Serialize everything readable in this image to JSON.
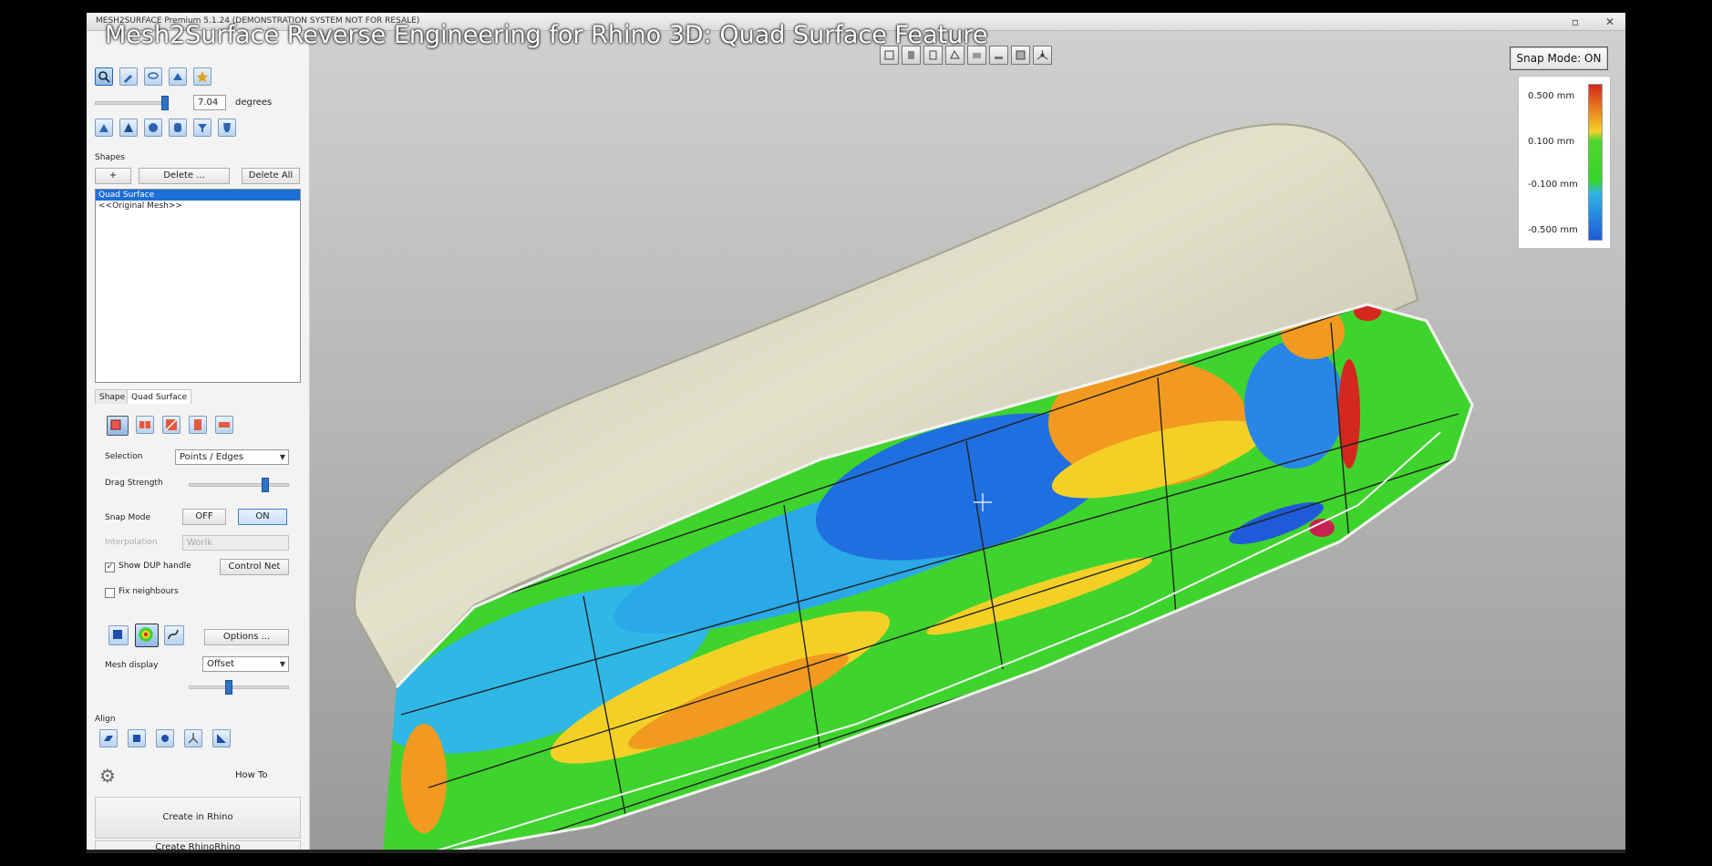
{
  "window": {
    "app_title": "MESH2SURFACE Premium 5.1.24 (DEMONSTRATION SYSTEM NOT FOR RESALE)",
    "video_title": "Mesh2Surface Reverse Engineering for Rhino 3D: Quad Surface Feature"
  },
  "panel": {
    "angle_value": "7.04",
    "angle_unit": "degrees",
    "shapes_header": "Shapes",
    "add_label": "+",
    "delete_label": "Delete ...",
    "delete_all_label": "Delete All",
    "shape_items": [
      "Quad Surface",
      "<<Original Mesh>>"
    ],
    "tabs": [
      "Shape",
      "Quad Surface"
    ],
    "selection_label": "Selection",
    "selection_value": "Points / Edges",
    "drag_strength_label": "Drag Strength",
    "snap_mode_label": "Snap Mode",
    "snap_off_label": "OFF",
    "snap_on_label": "ON",
    "interpolation_label": "Interpolation",
    "interpolation_value": "Worlk",
    "show_handle_label": "Show DUP handle",
    "control_net_label": "Control Net",
    "fix_neighbours_label": "Fix neighbours",
    "options_label": "Options ...",
    "mesh_display_label": "Mesh display",
    "mesh_display_value": "Offset",
    "align_header": "Align",
    "how_to_label": "How To",
    "create_in_rhino_label": "Create in Rhino",
    "create_rhinorhino_label": "Create RhinoRhino"
  },
  "viewport": {
    "snap_mode_button": "Snap Mode: ON",
    "legend": [
      {
        "label": "0.500 mm"
      },
      {
        "label": "0.100 mm"
      },
      {
        "label": "-0.100 mm"
      },
      {
        "label": "-0.500 mm"
      }
    ]
  },
  "colors": {
    "accent": "#1b6fd6",
    "deviation_red": "#d4281e",
    "deviation_yellow": "#f5d32a",
    "deviation_green": "#36d52c",
    "deviation_blue": "#1f5ad9",
    "mesh_beige": "#d8d4b8"
  }
}
